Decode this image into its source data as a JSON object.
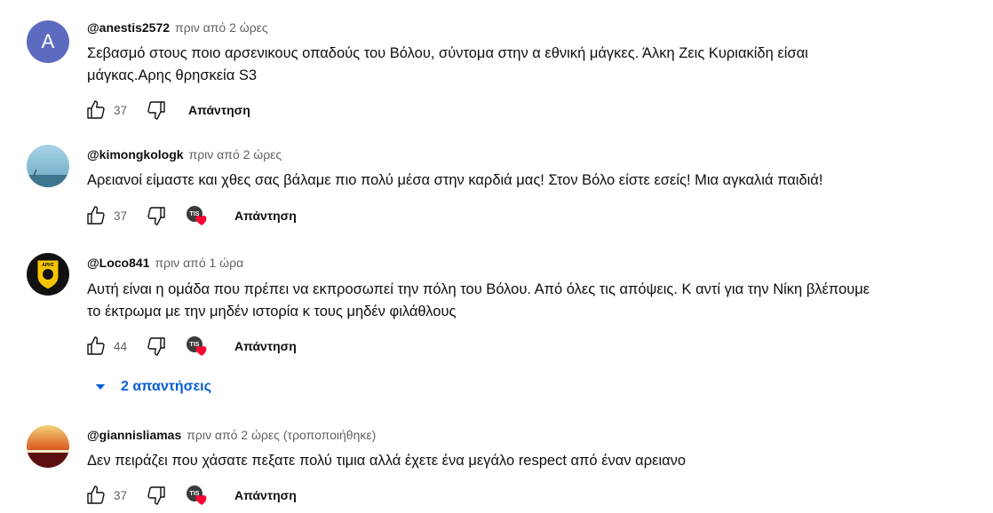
{
  "comments": [
    {
      "author": "@anestis2572",
      "avatar_letter": "A",
      "time": "πριν από 2 ώρες",
      "edited": "",
      "text_lines": [
        "Σεβασμό στους ποιο αρσενικους οπαδούς του Βόλου, σύντομα στην α εθνική μάγκες. Άλκη Ζεις Κυριακίδη είσαι",
        "μάγκας.Αρης θρησκεία S3"
      ],
      "likes": "37",
      "hearted": false,
      "reply_label": "Απάντηση"
    },
    {
      "author": "@kimongkologk",
      "time": "πριν από 2 ώρες",
      "edited": "",
      "text_lines": [
        "Αρειανοί είμαστε και χθες σας βάλαμε πιο πολύ μέσα στην καρδιά μας! Στον Βόλο είστε εσείς! Μια αγκαλιά παιδιά!"
      ],
      "likes": "37",
      "hearted": true,
      "reply_label": "Απάντηση"
    },
    {
      "author": "@Loco841",
      "time": "πριν από 1 ώρα",
      "edited": "",
      "avatar_text": "ΑΡΗΣ",
      "text_lines": [
        "Αυτή είναι η ομάδα που πρέπει να εκπροσωπεί την πόλη του Βόλου. Από όλες τις απόψεις. Κ αντί για την Νίκη βλέπουμε",
        "το έκτρωμα με την μηδέν ιστορία κ τους μηδέν φιλάθλους"
      ],
      "likes": "44",
      "hearted": true,
      "reply_label": "Απάντηση",
      "replies_toggle": "2 απαντήσεις"
    },
    {
      "author": "@giannisliamas",
      "time": "πριν από 2 ώρες",
      "edited": "(τροποποιήθηκε)",
      "text_lines": [
        "Δεν πειράζει που χάσατε πεξατε πολύ τιμια αλλά έχετε ένα μεγάλο respect από έναν αρειανο"
      ],
      "likes": "37",
      "hearted": true,
      "reply_label": "Απάντηση"
    }
  ],
  "hearted_badge_text": "TIS",
  "colors": {
    "link_blue": "#065fd4",
    "heart_red": "#ff0033",
    "avatar_a": "#5c6bc0",
    "muted": "#606060"
  }
}
